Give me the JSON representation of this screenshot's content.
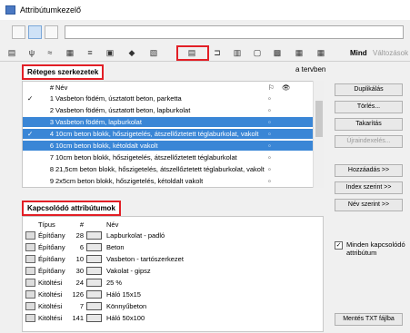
{
  "window": {
    "title": "Attribútumkezelő"
  },
  "tabs_right": {
    "mind": "Mind",
    "valtozasok": "Változások"
  },
  "top_panel": {
    "header": "Réteges szerkezetek",
    "subtitle": "a tervben",
    "columns": {
      "num": "#",
      "name": "Név"
    },
    "rows": [
      {
        "num": "1",
        "name": "Vasbeton födém, úsztatott beton, parketta",
        "checked": true,
        "selected": false
      },
      {
        "num": "2",
        "name": "Vasbeton födém, úsztatott beton, lapburkolat",
        "checked": false,
        "selected": false
      },
      {
        "num": "3",
        "name": "Vasbeton födém, lapburkolat",
        "checked": false,
        "selected": true
      },
      {
        "num": "4",
        "name": "10cm beton blokk, hőszigetelés, átszellőztetett téglaburkolat, vakolt",
        "checked": true,
        "selected": true
      },
      {
        "num": "6",
        "name": "10cm beton blokk, kétoldalt vakolt",
        "checked": false,
        "selected": true
      },
      {
        "num": "7",
        "name": "10cm beton blokk, hőszigetelés, átszellőztetett téglaburkolat",
        "checked": false,
        "selected": false
      },
      {
        "num": "8",
        "name": "21,5cm beton blokk, hőszigetelés, átszellőztetett téglaburkolat, vakolt",
        "checked": false,
        "selected": false
      },
      {
        "num": "9",
        "name": "2x5cm beton blokk, hőszigetelés, kétoldalt vakolt",
        "checked": false,
        "selected": false
      }
    ]
  },
  "right_buttons": {
    "duplikalas": "Duplikálás",
    "torles": "Törlés...",
    "takaritas": "Takarítás",
    "ujraindexeles": "Újraindexelés...",
    "hozzaadas": "Hozzáadás >>",
    "index_szerint": "Index szerint >>",
    "nev_szerint": "Név szerint >>",
    "minden_kapcsolodo": "Minden kapcsolódó attribútum",
    "mentes_txt": "Mentés TXT fájlba"
  },
  "bottom_panel": {
    "header": "Kapcsolódó attribútumok",
    "columns": {
      "tipus": "Típus",
      "num": "#",
      "nev": "Név"
    },
    "rows": [
      {
        "tipus": "Építőany",
        "num": "28",
        "nev": "Lapburkolat - padló"
      },
      {
        "tipus": "Építőany",
        "num": "6",
        "nev": "Beton"
      },
      {
        "tipus": "Építőany",
        "num": "10",
        "nev": "Vasbeton - tartószerkezet"
      },
      {
        "tipus": "Építőany",
        "num": "30",
        "nev": "Vakolat - gipsz"
      },
      {
        "tipus": "Kitöltési",
        "num": "24",
        "nev": "25 %"
      },
      {
        "tipus": "Kitöltési",
        "num": "126",
        "nev": "Háló 15x15"
      },
      {
        "tipus": "Kitöltési",
        "num": "7",
        "nev": "Könnyűbeton"
      },
      {
        "tipus": "Kitöltési",
        "num": "141",
        "nev": "Háló 50x100"
      }
    ]
  }
}
